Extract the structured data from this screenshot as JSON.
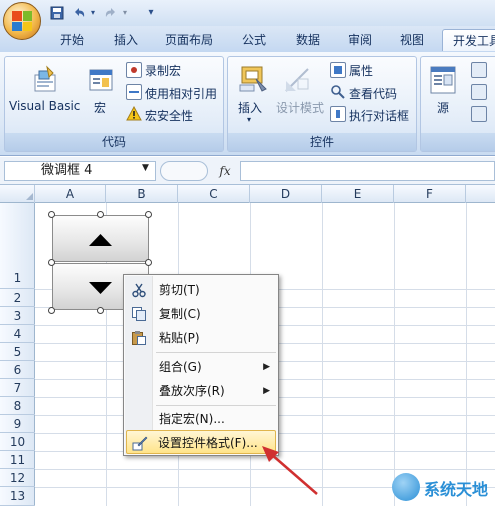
{
  "quick_access": {
    "save_icon": "save-icon",
    "undo_icon": "undo-icon",
    "redo_icon": "redo-icon",
    "customize_icon": "chevron-down-icon"
  },
  "tabs": [
    {
      "label": "开始"
    },
    {
      "label": "插入"
    },
    {
      "label": "页面布局"
    },
    {
      "label": "公式"
    },
    {
      "label": "数据"
    },
    {
      "label": "审阅"
    },
    {
      "label": "视图"
    },
    {
      "label": "开发工具",
      "active": true
    }
  ],
  "ribbon": {
    "code": {
      "label": "代码",
      "visual_basic": "Visual Basic",
      "macros": "宏",
      "record_macro": "录制宏",
      "relative_ref": "使用相对引用",
      "macro_security": "宏安全性"
    },
    "controls": {
      "label": "控件",
      "insert": "插入",
      "design_mode": "设计模式",
      "properties": "属性",
      "view_code": "查看代码",
      "run_dialog": "执行对话框"
    },
    "xml": {
      "source": "源"
    }
  },
  "formula_bar": {
    "name_box": "微调框 4",
    "fx": "fx",
    "value": ""
  },
  "columns": [
    "A",
    "B",
    "C",
    "D",
    "E",
    "F"
  ],
  "rows": [
    "1",
    "2",
    "3",
    "4",
    "5",
    "6",
    "7",
    "8",
    "9",
    "10",
    "11",
    "12",
    "13"
  ],
  "context_menu": {
    "items": [
      {
        "label": "剪切(T)",
        "icon": "scissors-icon"
      },
      {
        "label": "复制(C)",
        "icon": "copy-icon"
      },
      {
        "label": "粘贴(P)",
        "icon": "paste-icon"
      },
      {
        "label": "组合(G)",
        "submenu": true
      },
      {
        "label": "叠放次序(R)",
        "submenu": true
      },
      {
        "label": "指定宏(N)..."
      },
      {
        "label": "设置控件格式(F)...",
        "icon": "format-control-icon",
        "highlighted": true
      }
    ]
  },
  "watermark": {
    "text": "系统天地"
  },
  "colors": {
    "accent": "#d03030",
    "ribbon": "#dce8f6",
    "highlight": "#ffe48a"
  }
}
